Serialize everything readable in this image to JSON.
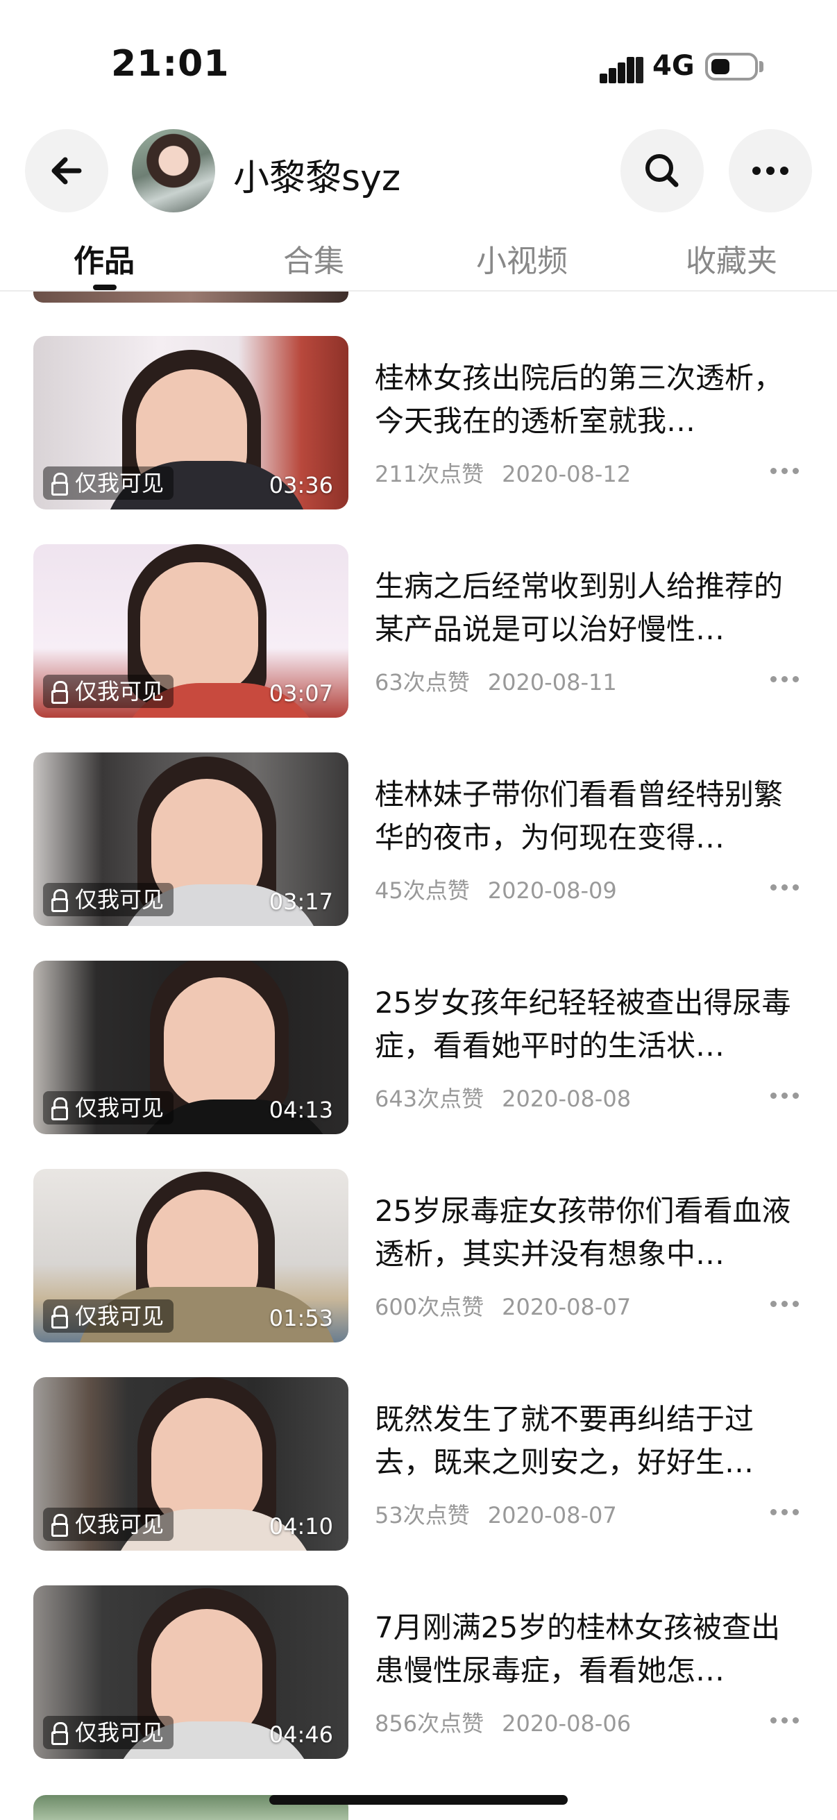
{
  "status_bar": {
    "time": "21:01",
    "network": "4G"
  },
  "header": {
    "username": "小黎黎syz",
    "icons": [
      "back-arrow-icon",
      "search-icon",
      "more-icon"
    ]
  },
  "tabs": [
    {
      "label": "作品",
      "active": true
    },
    {
      "label": "合集",
      "active": false
    },
    {
      "label": "小视频",
      "active": false
    },
    {
      "label": "收藏夹",
      "active": false
    }
  ],
  "videos": [
    {
      "title": "桂林女孩出院后的第三次透析，今天我在的透析室就我…",
      "likes": "211次点赞",
      "date": "2020-08-12",
      "duration": "03:36",
      "badge": "仅我可见"
    },
    {
      "title": "生病之后经常收到别人给推荐的某产品说是可以治好慢性…",
      "likes": "63次点赞",
      "date": "2020-08-11",
      "duration": "03:07",
      "badge": "仅我可见"
    },
    {
      "title": "桂林妹子带你们看看曾经特别繁华的夜市，为何现在变得…",
      "likes": "45次点赞",
      "date": "2020-08-09",
      "duration": "03:17",
      "badge": "仅我可见"
    },
    {
      "title": "25岁女孩年纪轻轻被查出得尿毒症，看看她平时的生活状…",
      "likes": "643次点赞",
      "date": "2020-08-08",
      "duration": "04:13",
      "badge": "仅我可见"
    },
    {
      "title": "25岁尿毒症女孩带你们看看血液透析，其实并没有想象中…",
      "likes": "600次点赞",
      "date": "2020-08-07",
      "duration": "01:53",
      "badge": "仅我可见"
    },
    {
      "title": "既然发生了就不要再纠结于过去，既来之则安之，好好生…",
      "likes": "53次点赞",
      "date": "2020-08-07",
      "duration": "04:10",
      "badge": "仅我可见"
    },
    {
      "title": "7月刚满25岁的桂林女孩被查出患慢性尿毒症，看看她怎…",
      "likes": "856次点赞",
      "date": "2020-08-06",
      "duration": "04:46",
      "badge": "仅我可见"
    }
  ],
  "colors": {
    "text": "#111111",
    "meta": "#999999",
    "tab_inactive": "#888888",
    "button_bg": "#f2f2f2"
  }
}
